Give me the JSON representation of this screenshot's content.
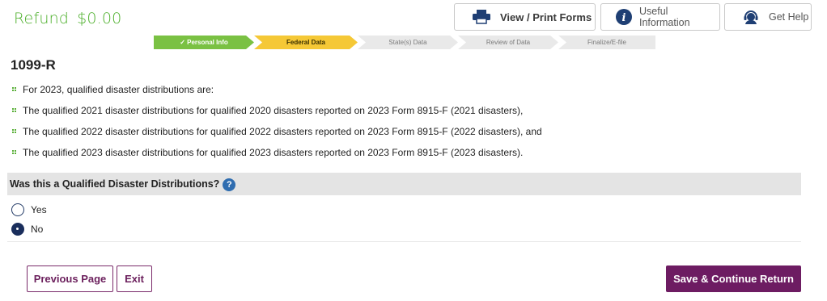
{
  "header": {
    "refund_label": "Refund",
    "refund_amount": "$0.00",
    "buttons": {
      "view_print": "View / Print Forms",
      "useful_info": "Useful Information",
      "get_help": "Get Help"
    }
  },
  "progress": {
    "steps": [
      {
        "label": "✓ Personal Info",
        "state": "complete"
      },
      {
        "label": "Federal Data",
        "state": "current"
      },
      {
        "label": "State(s) Data",
        "state": "pending"
      },
      {
        "label": "Review of Data",
        "state": "pending"
      },
      {
        "label": "Finalize/E-file",
        "state": "pending"
      }
    ]
  },
  "page": {
    "title": "1099-R",
    "bullets": [
      "For 2023, qualified disaster distributions are:",
      "The qualified 2021 disaster distributions for qualified 2020 disasters reported on 2023 Form 8915-F (2021 disasters),",
      "The qualified 2022 disaster distributions for qualified 2022 disasters reported on 2023 Form 8915-F (2022 disasters), and",
      "The qualified 2023 disaster distributions for qualified 2023 disasters reported on 2023 Form 8915-F (2023 disasters)."
    ]
  },
  "question": {
    "text": "Was this a Qualified Disaster Distributions?",
    "help_glyph": "?",
    "options": [
      {
        "label": "Yes",
        "selected": false
      },
      {
        "label": "No",
        "selected": true
      }
    ]
  },
  "footer": {
    "previous_label": "Previous Page",
    "exit_label": "Exit",
    "save_label": "Save & Continue Return"
  },
  "colors": {
    "refund_green": "#4caf2a",
    "step_complete": "#7ac143",
    "step_current": "#f5c836",
    "step_pending": "#e9e9e9",
    "primary_purple": "#6d1c62",
    "help_blue": "#2f6db0"
  }
}
